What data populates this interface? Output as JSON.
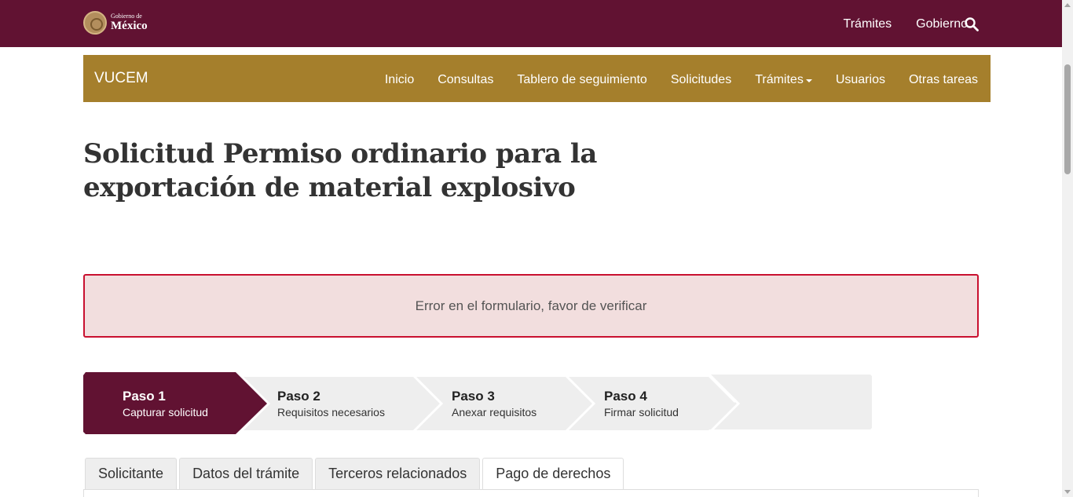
{
  "header": {
    "logo_small": "Gobierno de",
    "logo_big": "México",
    "nav": [
      "Trámites",
      "Gobierno"
    ]
  },
  "subheader": {
    "brand": "VUCEM",
    "nav": [
      "Inicio",
      "Consultas",
      "Tablero de seguimiento",
      "Solicitudes",
      "Trámites",
      "Usuarios",
      "Otras tareas"
    ]
  },
  "page": {
    "title": "Solicitud Permiso ordinario para la exportación de material explosivo"
  },
  "alert": {
    "message": "Error en el formulario, favor de verificar"
  },
  "wizard": {
    "steps": [
      {
        "label": "Paso 1",
        "desc": "Capturar solicitud"
      },
      {
        "label": "Paso 2",
        "desc": "Requisitos necesarios"
      },
      {
        "label": "Paso 3",
        "desc": "Anexar requisitos"
      },
      {
        "label": "Paso 4",
        "desc": "Firmar solicitud"
      }
    ],
    "active_index": 0
  },
  "tabs": [
    "Solicitante",
    "Datos del trámite",
    "Terceros relacionados",
    "Pago de derechos"
  ],
  "active_tab": 3,
  "colors": {
    "primary": "#611232",
    "gold": "#a57f2c",
    "alert_bg": "#f2dede",
    "alert_border": "#c9102f",
    "step_inactive": "#eeeeee"
  },
  "icons": {
    "search": "search-icon",
    "logo": "gobierno-seal-icon",
    "dropdown": "caret-down-icon"
  }
}
